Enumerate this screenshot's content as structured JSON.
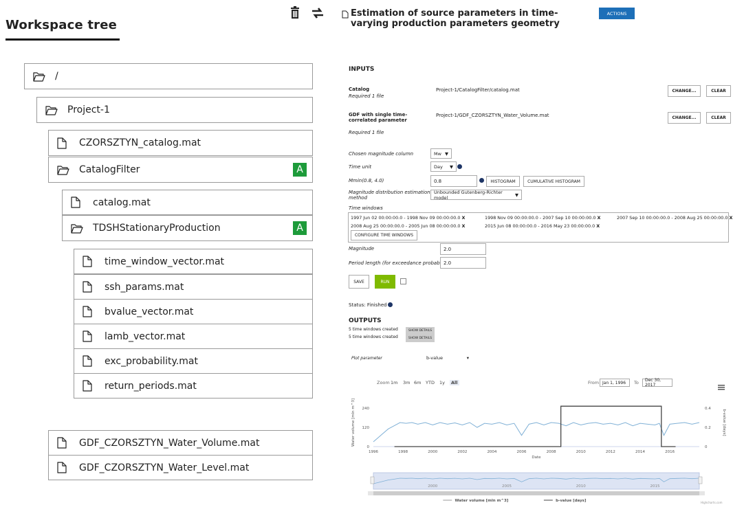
{
  "workspace": {
    "title": "Workspace tree",
    "nodes": [
      {
        "label": "/",
        "icon": "folder-open-icon"
      },
      {
        "label": "Project-1",
        "icon": "folder-open-icon"
      },
      {
        "label": "CZORSZTYN_catalog.mat",
        "icon": "file-icon"
      },
      {
        "label": "CatalogFilter",
        "icon": "folder-open-icon",
        "badge": "A"
      },
      {
        "label": "catalog.mat",
        "icon": "file-icon"
      },
      {
        "label": "TDSHStationaryProduction",
        "icon": "folder-open-icon",
        "badge": "A"
      },
      {
        "label": "time_window_vector.mat",
        "icon": "file-icon"
      },
      {
        "label": "ssh_params.mat",
        "icon": "file-icon"
      },
      {
        "label": "bvalue_vector.mat",
        "icon": "file-icon"
      },
      {
        "label": "lamb_vector.mat",
        "icon": "file-icon"
      },
      {
        "label": "exc_probability.mat",
        "icon": "file-icon"
      },
      {
        "label": "return_periods.mat",
        "icon": "file-icon"
      },
      {
        "label": "GDF_CZORSZTYN_Water_Volume.mat",
        "icon": "file-icon"
      },
      {
        "label": "GDF_CZORSZTYN_Water_Level.mat",
        "icon": "file-icon"
      }
    ]
  },
  "toolbar": {
    "delete_icon": "trash-icon",
    "sync_icon": "sync-icon"
  },
  "app": {
    "title": "Estimation of source parameters in time-varying production parameters geometry",
    "actions_label": "ACTIONS",
    "accent": "#1d6fb8"
  },
  "inputs": {
    "heading": "INPUTS",
    "catalog": {
      "label": "Catalog",
      "hint": "Required 1 file",
      "path": "Project-1/CatalogFilter/catalog.mat"
    },
    "gdf": {
      "label": "GDF with single time-correlated parameter",
      "hint": "Required 1 file",
      "path": "Project-1/GDF_CZORSZTYN_Water_Volume.mat"
    },
    "change_label": "CHANGE...",
    "clear_label": "CLEAR",
    "magnitude_column": {
      "label": "Chosen magnitude column",
      "value": "Mw"
    },
    "time_unit": {
      "label": "Time unit",
      "value": "Day"
    },
    "mmin": {
      "label": "Mmin(0.8, 4.0)",
      "value": "0.8"
    },
    "histogram_label": "HISTOGRAM",
    "cumulative_label": "CUMULATIVE HISTOGRAM",
    "distribution": {
      "label": "Magnitude distribution estimation method",
      "value": "Unbounded Gutenberg-Richter model"
    },
    "time_windows": {
      "label": "Time windows",
      "entries": [
        "1997 Jun 02 00:00:00.0 - 1998 Nov 09 00:00:00.0",
        "1998 Nov 09 00:00:00.0 - 2007 Sep 10  00:00:00.0",
        "2007 Sep 10 00:00:00.0 - 2008 Aug 25 00:00:00.0",
        "2008 Aug 25 00:00:00.0 - 2005 Jun 08  00:00:00.0",
        "2015 Jun 08 00:00:00.0 - 2016 May 23  00:00:00.0"
      ],
      "remove": "X",
      "configure_label": "CONFIGURE TIME WINDOWS"
    },
    "magnitude": {
      "label": "Magnitude",
      "value": "2.0"
    },
    "period": {
      "label": "Period length (for exceedance probability)",
      "value": "2.0"
    },
    "save_label": "SAVE",
    "run_label": "RUN",
    "run_color": "#7fba00",
    "status": "Status: Finished"
  },
  "outputs": {
    "heading": "OUTPUTS",
    "rows": [
      {
        "text": "5 time windows created",
        "button": "SHOW DETAILS"
      },
      {
        "text": "5 time windows created",
        "button": "SHOW DETAILS"
      }
    ],
    "plot_param": {
      "label": "Plot parameter",
      "value": "b-value"
    }
  },
  "chart_controls": {
    "zoom_label": "Zoom",
    "zoom_options": [
      "1m",
      "3m",
      "6m",
      "YTD",
      "1y",
      "All"
    ],
    "from_label": "From",
    "from_value": "Jan 1, 1996",
    "to_label": "To",
    "to_value": "Dec 30, 2017",
    "menu_icon": "hamburger-menu-icon",
    "credit": "Highcharts.com"
  },
  "chart_data": {
    "type": "line",
    "xlabel": "Date",
    "ylabel": "Water volume [mln m^3]",
    "y2label": "b-value [days]",
    "xlim": [
      1996,
      2017.99
    ],
    "ylim": [
      0,
      300
    ],
    "y2lim": [
      0,
      0.5
    ],
    "x_ticks": [
      "1996",
      "1998",
      "2000",
      "2002",
      "2004",
      "2006",
      "2008",
      "2010",
      "2012",
      "2014",
      "2016"
    ],
    "y_ticks": [
      "0",
      "120",
      "240"
    ],
    "y2_ticks": [
      "0",
      "0.2",
      "0.4"
    ],
    "navigator_ticks": [
      "2000",
      "2005",
      "2010",
      "2015"
    ],
    "series": [
      {
        "name": "Water volume [mln m^3]",
        "color": "#7fb0d6",
        "x": [
          1996,
          1996.5,
          1997,
          1997.4,
          1997.8,
          1998.2,
          1998.6,
          1999,
          1999.5,
          2000,
          2000.5,
          2001,
          2001.5,
          2002,
          2002.5,
          2003,
          2003.5,
          2004,
          2004.5,
          2005,
          2005.5,
          2006,
          2006.5,
          2007,
          2007.5,
          2008,
          2008.5,
          2009,
          2009.5,
          2010,
          2010.5,
          2011,
          2011.5,
          2012,
          2012.5,
          2013,
          2013.5,
          2014,
          2014.5,
          2015,
          2015.3,
          2015.6,
          2016,
          2016.5,
          2017,
          2017.5,
          2018
        ],
        "values": [
          30,
          70,
          110,
          130,
          150,
          145,
          150,
          140,
          150,
          135,
          150,
          140,
          148,
          135,
          150,
          120,
          145,
          140,
          150,
          135,
          145,
          70,
          140,
          150,
          135,
          150,
          145,
          130,
          150,
          135,
          145,
          150,
          140,
          145,
          135,
          150,
          130,
          145,
          140,
          135,
          145,
          70,
          140,
          145,
          150,
          140,
          150
        ]
      },
      {
        "name": "b-value [days]",
        "color": "#444444",
        "x": [
          1997.42,
          1998.86,
          1998.86,
          2008.65,
          2008.65,
          2015.43,
          2015.43,
          2016.39
        ],
        "values": [
          0,
          0,
          0,
          0,
          0.42,
          0.42,
          0,
          0
        ]
      }
    ],
    "legend": "bottom"
  }
}
